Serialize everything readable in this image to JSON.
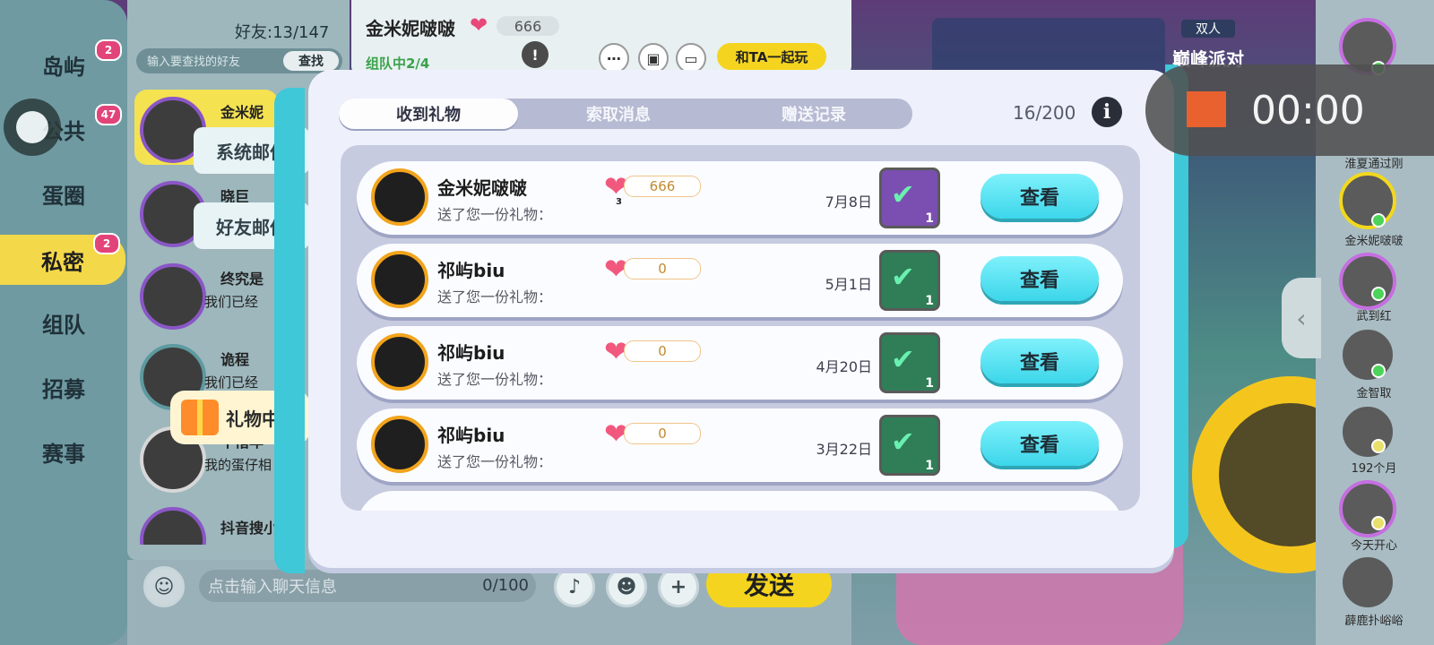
{
  "left_nav": {
    "items": [
      {
        "label": "岛屿",
        "badge": "2"
      },
      {
        "label": "公共",
        "badge": "47"
      },
      {
        "label": "蛋圈",
        "badge": ""
      },
      {
        "label": "私密",
        "badge": "2"
      },
      {
        "label": "组队",
        "badge": ""
      },
      {
        "label": "招募",
        "badge": ""
      },
      {
        "label": "赛事",
        "badge": ""
      }
    ]
  },
  "friends": {
    "count_label": "好友:13/147",
    "search_placeholder": "输入要查找的好友",
    "search_button": "查找",
    "rows": [
      {
        "name": "金米妮",
        "message": ""
      },
      {
        "name": "晓巨",
        "message": ""
      },
      {
        "name": "终究是",
        "message": "我们已经"
      },
      {
        "name": "诡程",
        "message": "我们已经"
      },
      {
        "name": "十惜年",
        "message": "我的蛋仔相"
      },
      {
        "name": "抖音搜小",
        "message": ""
      }
    ],
    "mail_tabs": {
      "system": "系统邮件",
      "friend": "好友邮件"
    },
    "gift_center": "礼物中心"
  },
  "chat": {
    "name": "金米妮啵啵",
    "score": "666",
    "team_status": "组队中2/4",
    "play_together": "和TA一起玩",
    "input_placeholder": "点击输入聊天信息",
    "input_count": "0/100",
    "send": "发送"
  },
  "game": {
    "mode_badge": "双人",
    "mode_name": "巅峰派对"
  },
  "recording": {
    "time": "00:00"
  },
  "gift_modal": {
    "tabs": [
      "收到礼物",
      "索取消息",
      "赠送记录"
    ],
    "active_tab": 0,
    "count": "16/200",
    "rows": [
      {
        "sender": "金米妮啵啵",
        "desc": "送了您一份礼物：",
        "level": "3",
        "score": "666",
        "date": "7月8日",
        "qty": "1",
        "item_color": "purple",
        "action": "查看"
      },
      {
        "sender": "祁屿biu",
        "desc": "送了您一份礼物：",
        "level": "",
        "score": "0",
        "date": "5月1日",
        "qty": "1",
        "item_color": "green",
        "action": "查看"
      },
      {
        "sender": "祁屿biu",
        "desc": "送了您一份礼物：",
        "level": "",
        "score": "0",
        "date": "4月20日",
        "qty": "1",
        "item_color": "green",
        "action": "查看"
      },
      {
        "sender": "祁屿biu",
        "desc": "送了您一份礼物：",
        "level": "",
        "score": "0",
        "date": "3月22日",
        "qty": "1",
        "item_color": "green",
        "action": "查看"
      }
    ]
  },
  "right_panel": {
    "names": [
      "淮夏通过刚",
      "金米妮啵啵",
      "武到红",
      "金智取",
      "192个月",
      "今天开心",
      "薜鹿扑峪峪"
    ]
  },
  "colors": {
    "accent_yellow": "#f4d41e",
    "view_button": "#3cd6ea",
    "modal_bg": "#eef1fb",
    "heart": "#f2587e"
  }
}
